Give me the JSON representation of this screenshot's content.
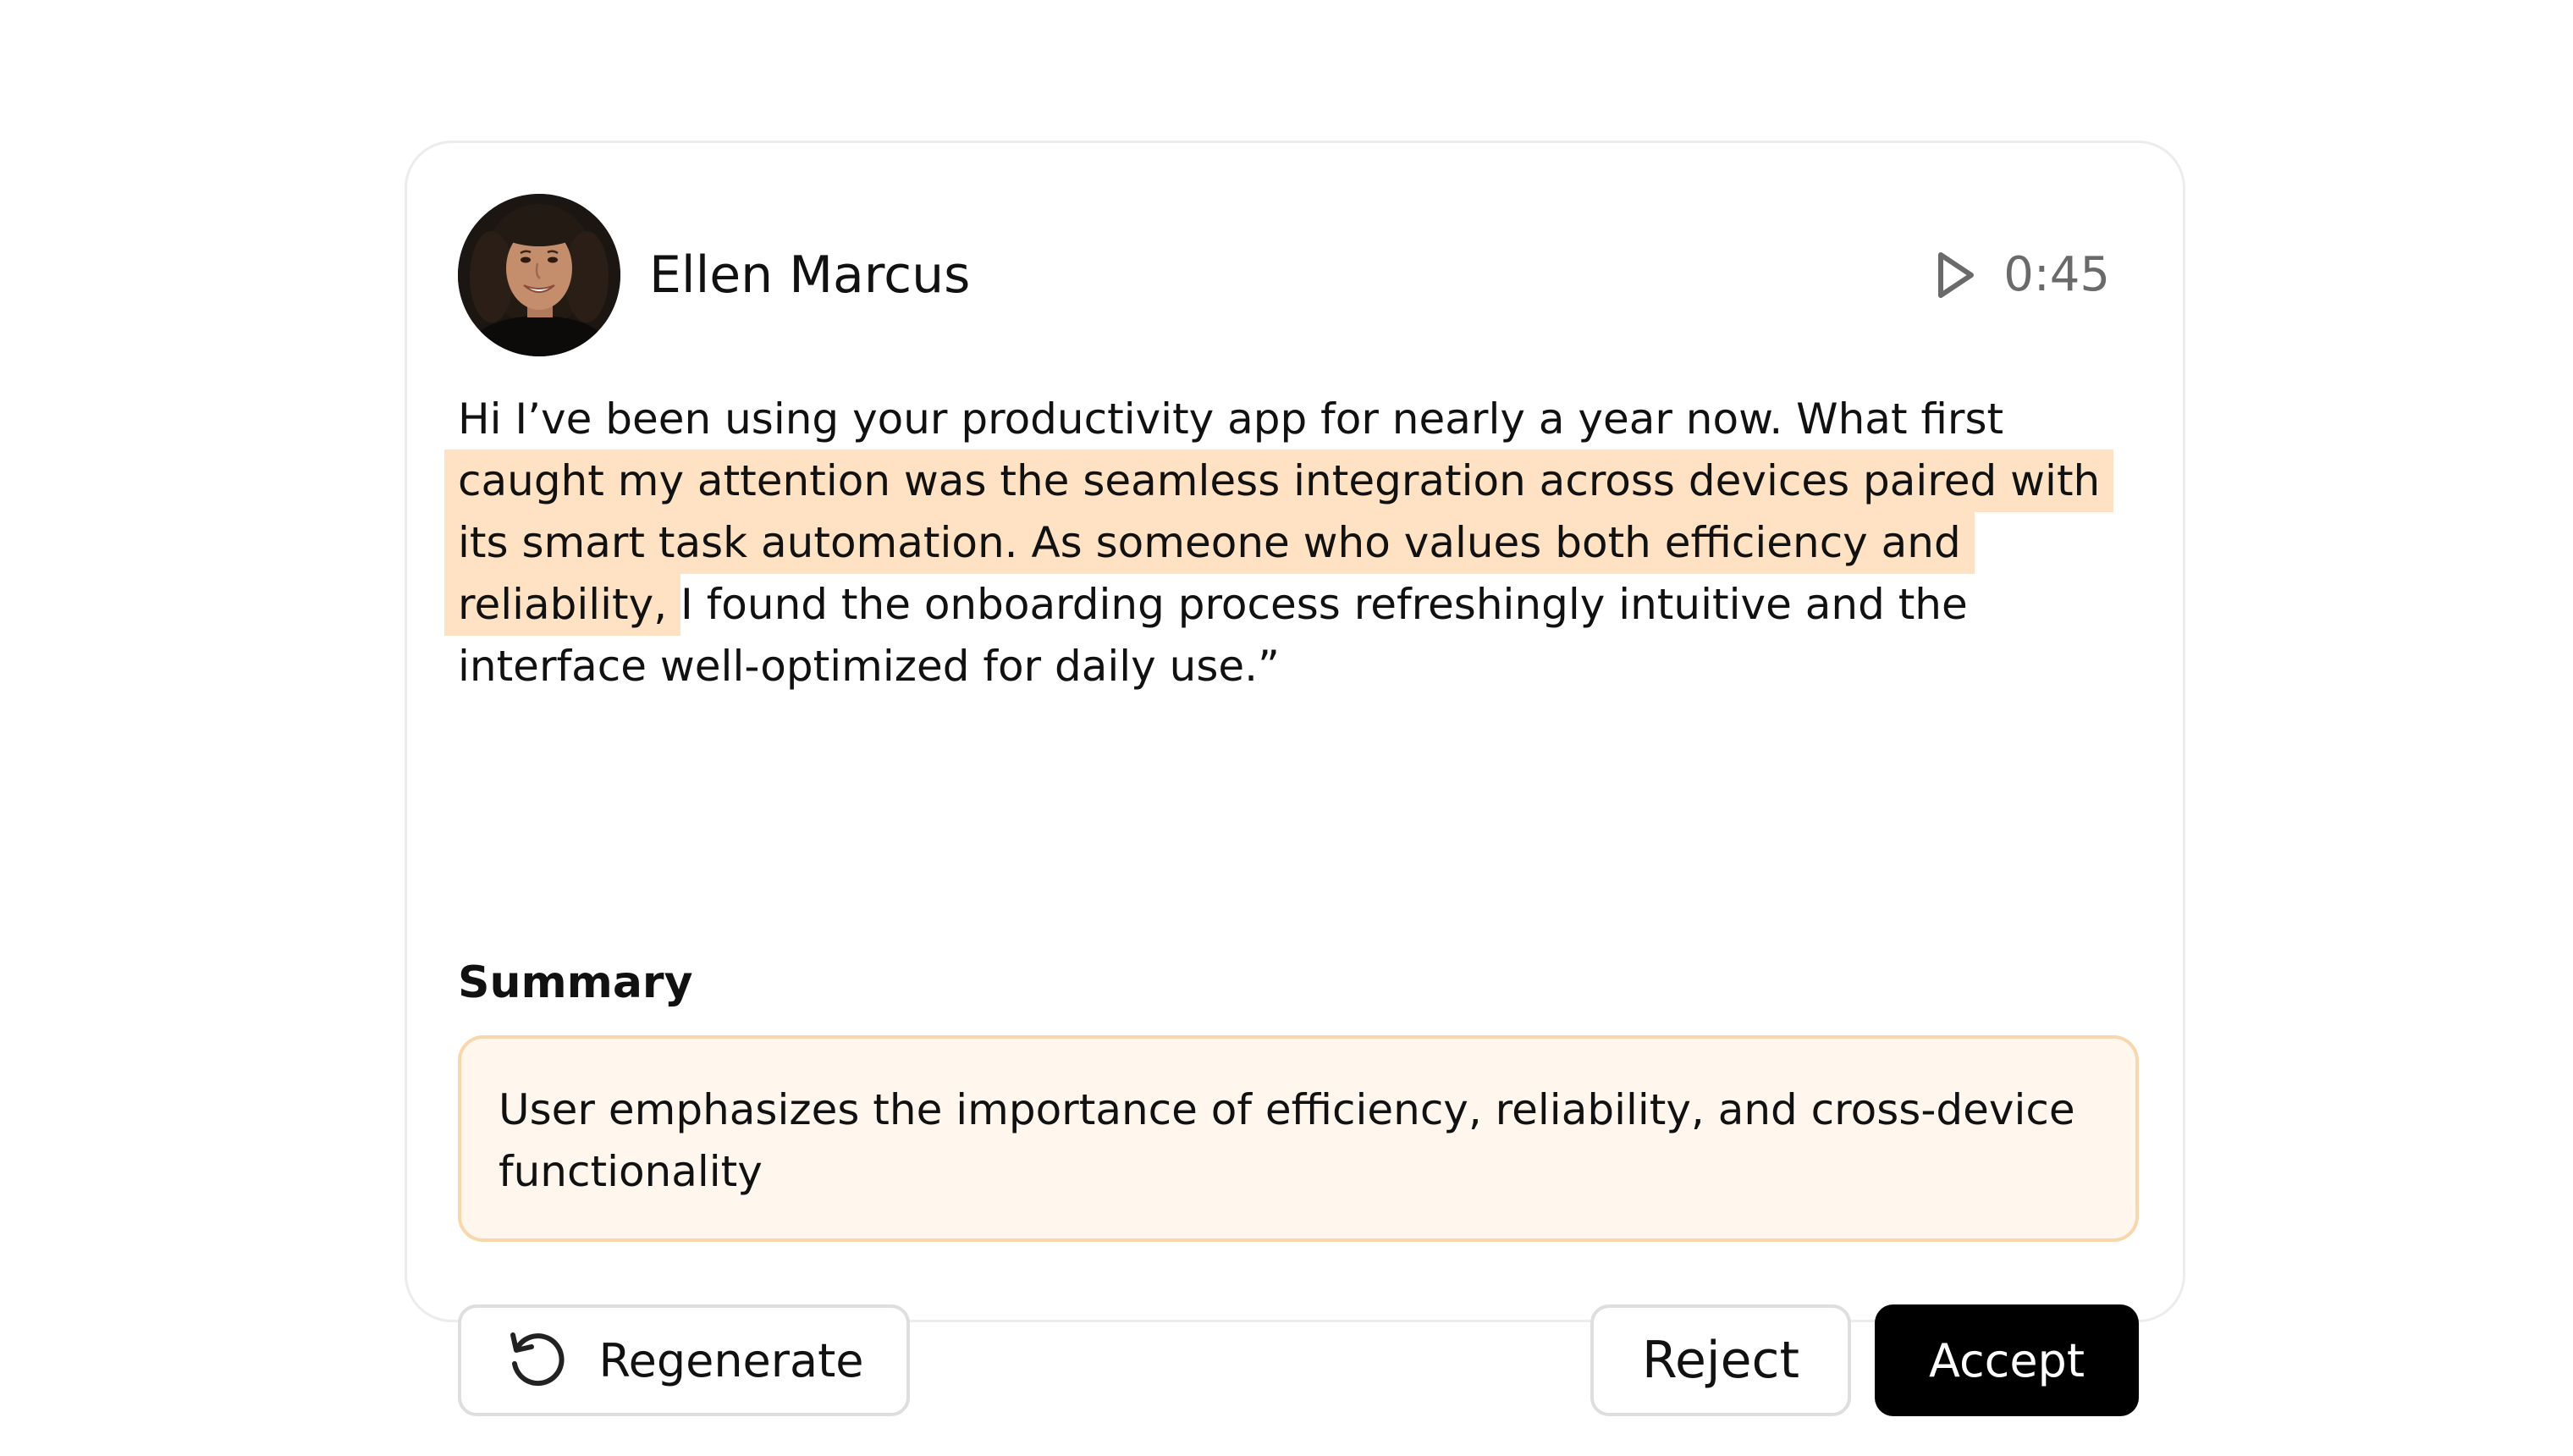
{
  "author": {
    "name": "Ellen Marcus",
    "avatar_icon": "person-portrait-avatar"
  },
  "audio": {
    "play_icon": "play-icon",
    "duration": "0:45"
  },
  "transcript": {
    "before": "Hi I’ve been using your productivity app for nearly a year now. What first ",
    "highlight": "caught my attention was the seamless integration across devices paired with its smart task automation. As someone who values both efficiency and reliability,",
    "after": " I found the onboarding process refreshingly intuitive and the interface well-optimized for daily use.”",
    "highlight_color": "#ffe2c4"
  },
  "summary": {
    "label": "Summary",
    "text": "User emphasizes the importance of efficiency, reliability, and cross-device functionality",
    "border_color": "#f8d7ad",
    "background_color": "#fff7ee"
  },
  "actions": {
    "regenerate_icon": "refresh-icon",
    "regenerate_label": "Regenerate",
    "reject_label": "Reject",
    "accept_label": "Accept",
    "accept_color": "#000000"
  }
}
